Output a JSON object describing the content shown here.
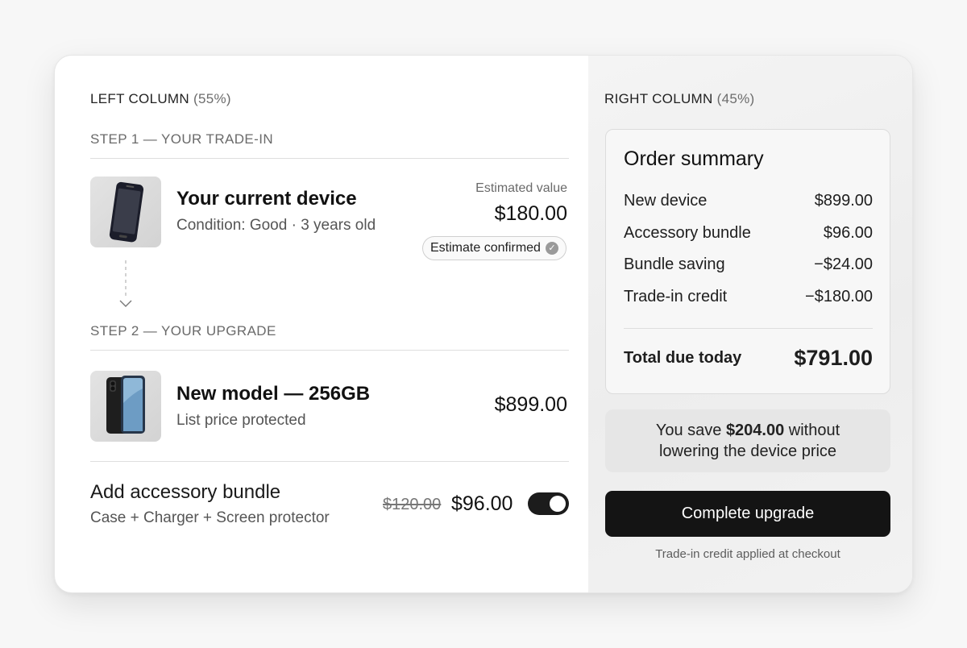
{
  "left_column": {
    "heading": "LEFT COLUMN",
    "heading_pct": "(55%)",
    "step1": {
      "label": "STEP 1 — YOUR TRADE-IN",
      "title": "Your current device",
      "subtitle": "Condition: Good · 3 years old",
      "value_label": "Estimated value",
      "value": "$180.00",
      "badge": "Estimate confirmed",
      "thumb_icon": "old-phone-icon"
    },
    "step2": {
      "label": "STEP 2 — YOUR UPGRADE",
      "title": "New model — 256GB",
      "subtitle": "List price protected",
      "price": "$899.00",
      "thumb_icon": "new-phone-icon"
    },
    "bundle": {
      "title": "Add accessory bundle",
      "subtitle": "Case + Charger + Screen protector",
      "old_price": "$120.00",
      "price": "$96.00",
      "enabled": true
    }
  },
  "right_column": {
    "heading": "RIGHT COLUMN",
    "heading_pct": "(45%)",
    "summary": {
      "title": "Order summary",
      "rows": [
        {
          "label": "New device",
          "value": "$899.00"
        },
        {
          "label": "Accessory bundle",
          "value": "$96.00"
        },
        {
          "label": "Bundle saving",
          "value": "−$24.00"
        },
        {
          "label": "Trade-in credit",
          "value": "−$180.00"
        }
      ],
      "total_label": "Total due today",
      "total_value": "$791.00"
    },
    "savings": {
      "prefix": "You save",
      "amount": "$204.00",
      "suffix": "without",
      "line2": "lowering the device price"
    },
    "cta_label": "Complete upgrade",
    "footnote": "Trade-in credit applied at checkout"
  },
  "colors": {
    "accent": "#141414",
    "panel": "#ededed",
    "muted_text": "#6a6a6a"
  }
}
